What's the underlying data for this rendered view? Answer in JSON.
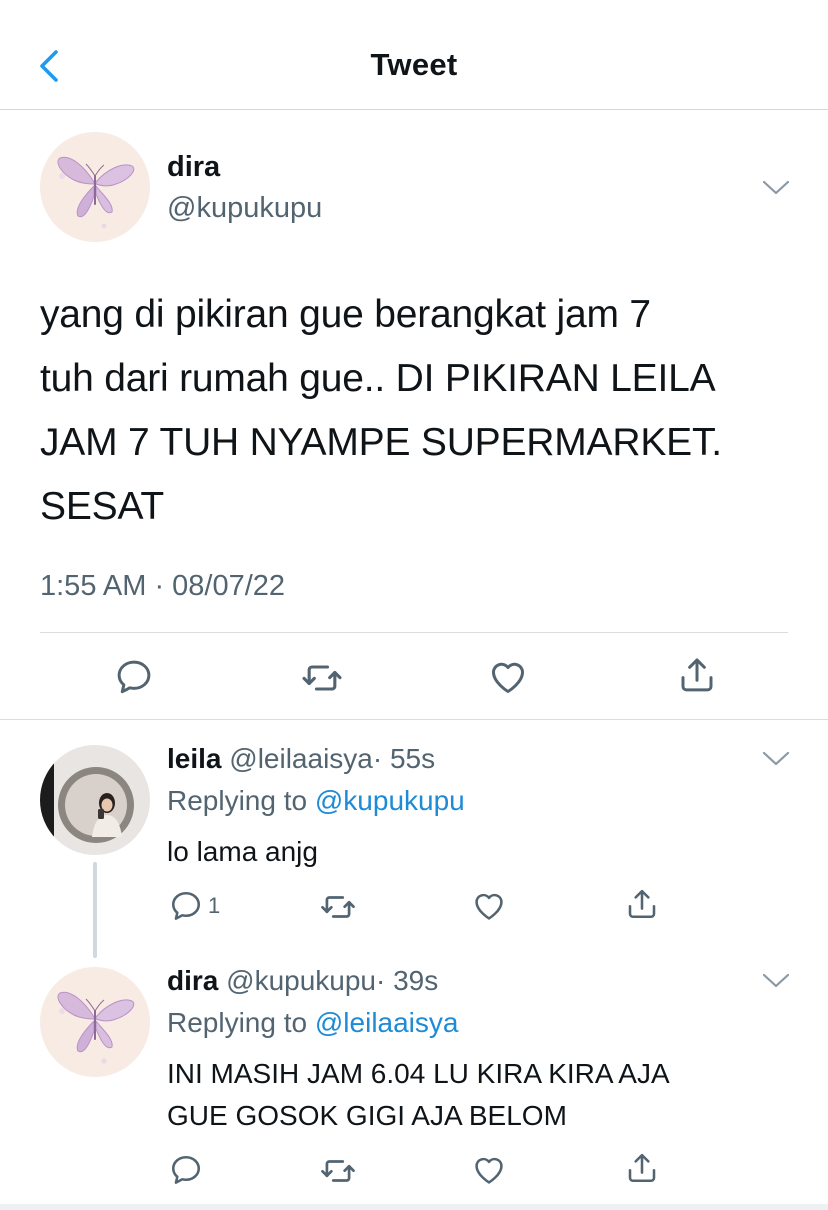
{
  "nav": {
    "title": "Tweet"
  },
  "tweet": {
    "name": "dira",
    "handle": "@kupukupu",
    "text_lines": [
      "yang di pikiran gue berangkat jam 7",
      "tuh dari rumah gue.. DI PIKIRAN LEILA",
      "JAM 7 TUH NYAMPE SUPERMARKET.",
      "SESAT"
    ],
    "timestamp": "1:55 AM · 08/07/22"
  },
  "replies": [
    {
      "name": "leila",
      "handle": "@leilaaisya",
      "time": "· 55s",
      "replying_prefix": "Replying to",
      "replying_to": "@kupukupu",
      "text_lines": [
        "lo lama anjg"
      ],
      "reply_count": "1"
    },
    {
      "name": "dira",
      "handle": "@kupukupu",
      "time": "· 39s",
      "replying_prefix": "Replying to",
      "replying_to": "@leilaaisya",
      "text_lines": [
        "INI MASIH JAM 6.04 LU KIRA KIRA AJA",
        "GUE GOSOK GIGI AJA BELOM"
      ],
      "reply_count": ""
    }
  ],
  "colors": {
    "accent": "#1d9bf0",
    "link": "#1d8bd6",
    "secondary_text": "#536471",
    "icon": "#536471"
  },
  "icons": {
    "back": "chevron-left-icon",
    "more": "chevron-down-icon",
    "reply": "speech-bubble-icon",
    "retweet": "retweet-icon",
    "like": "heart-icon",
    "share": "share-icon"
  }
}
